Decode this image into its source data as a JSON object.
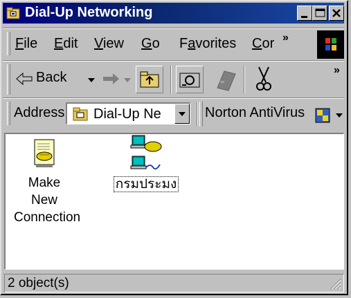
{
  "window": {
    "title": "Dial-Up Networking",
    "controls": {
      "minimize": "minimize",
      "maximize": "maximize",
      "close": "close"
    }
  },
  "menu": {
    "items": [
      {
        "label": "File"
      },
      {
        "label": "Edit"
      },
      {
        "label": "View"
      },
      {
        "label": "Go"
      },
      {
        "label": "Favorites"
      },
      {
        "label": "Cor"
      }
    ],
    "overflow": "»"
  },
  "toolbar": {
    "back_label": "Back",
    "overflow": "»"
  },
  "address": {
    "label": "Address",
    "value": "Dial-Up Ne",
    "norton_label": "Norton AntiVirus"
  },
  "content": {
    "items": [
      {
        "label_line1": "Make New",
        "label_line2": "Connection"
      },
      {
        "label_line1": "กรมประมง",
        "selected": true
      }
    ]
  },
  "status": {
    "text": "2 object(s)"
  },
  "colors": {
    "title_bar": "#000080",
    "face": "#c0c0c0",
    "window": "#ffffff"
  }
}
